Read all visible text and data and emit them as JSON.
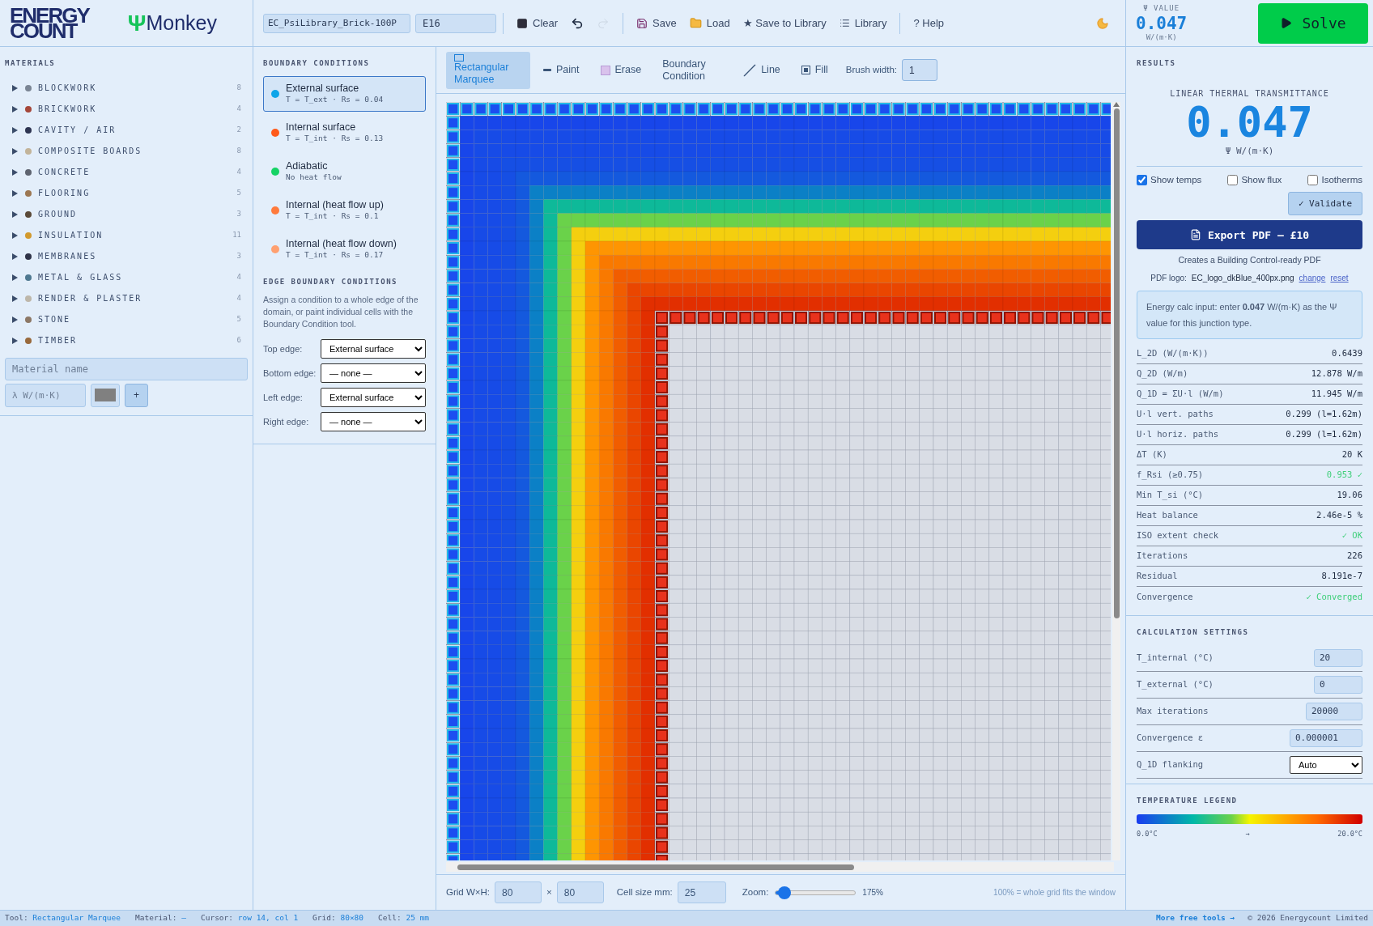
{
  "brand": {
    "wordmark_lines": [
      "ENERGY",
      "COUNT"
    ],
    "app_symbol": "Ψ",
    "app_name": "Monkey"
  },
  "toolbar": {
    "file_name": "EC_PsiLibrary_Brick-100P",
    "junction_code": "E16",
    "buttons": [
      {
        "kind": "clear",
        "label": "Clear",
        "disabled": false
      },
      {
        "kind": "undo",
        "disabled": false
      },
      {
        "kind": "redo",
        "disabled": true
      },
      {
        "kind": "save",
        "label": "Save",
        "disabled": false
      },
      {
        "kind": "load",
        "label": "Load",
        "disabled": false
      },
      {
        "kind": "text",
        "label": "★ Save to Library",
        "disabled": false
      },
      {
        "kind": "library",
        "label": "Library",
        "disabled": false
      },
      {
        "kind": "text",
        "label": "? Help",
        "disabled": false
      }
    ]
  },
  "psi_value": {
    "label": "Ψ VALUE",
    "value": "0.047",
    "unit": "W/(m·K)"
  },
  "solve_button": {
    "label": "Solve"
  },
  "materials": {
    "title": "MATERIALS",
    "groups": [
      {
        "name": "BLOCKWORK",
        "count": "8",
        "color": "#7a8594",
        "expanded": false
      },
      {
        "name": "BRICKWORK",
        "count": "4",
        "color": "#a5473a",
        "expanded": false
      },
      {
        "name": "CAVITY / AIR",
        "count": "2",
        "color": "#2e3552",
        "expanded": false
      },
      {
        "name": "COMPOSITE BOARDS",
        "count": "8",
        "color": "#c2b49a",
        "expanded": false
      },
      {
        "name": "CONCRETE",
        "count": "4",
        "color": "#5e6470",
        "expanded": false
      },
      {
        "name": "FLOORING",
        "count": "5",
        "color": "#9c7752",
        "expanded": false
      },
      {
        "name": "GROUND",
        "count": "3",
        "color": "#5a4a38",
        "expanded": false
      },
      {
        "name": "INSULATION",
        "count": "11",
        "color": "#d29a2e",
        "expanded": false
      },
      {
        "name": "MEMBRANES",
        "count": "3",
        "color": "#2f3348",
        "expanded": false
      },
      {
        "name": "METAL & GLASS",
        "count": "4",
        "color": "#4e7890",
        "expanded": false
      },
      {
        "name": "RENDER & PLASTER",
        "count": "4",
        "color": "#bdb7aa",
        "expanded": false
      },
      {
        "name": "STONE",
        "count": "5",
        "color": "#8c7866",
        "expanded": false
      },
      {
        "name": "TIMBER",
        "count": "6",
        "color": "#98693c",
        "expanded": false
      }
    ],
    "name_placeholder": "Material name",
    "conductivity_placeholder": "λ W/(m·K)",
    "swatch": {
      "color": "#808080"
    },
    "add_label": "+"
  },
  "boundary_conditions": {
    "title": "BOUNDARY CONDITIONS",
    "items": [
      {
        "name": "External surface",
        "detail": "T = T_ext · Rs = 0.04",
        "color": "#0ea5e9",
        "selected": true
      },
      {
        "name": "Internal surface",
        "detail": "T = T_int · Rs = 0.13",
        "color": "#ff5a1a",
        "selected": false
      },
      {
        "name": "Adiabatic",
        "detail": "No heat flow",
        "color": "#16d365",
        "selected": false
      },
      {
        "name": "Internal (heat flow up)",
        "detail": "T = T_int · Rs = 0.1",
        "color": "#ff7a3c",
        "selected": false
      },
      {
        "name": "Internal (heat flow down)",
        "detail": "T = T_int · Rs = 0.17",
        "color": "#ffa070",
        "selected": false
      }
    ]
  },
  "edge_conditions": {
    "title": "EDGE BOUNDARY CONDITIONS",
    "description": "Assign a condition to a whole edge of the domain, or paint individual cells with the Boundary Condition tool.",
    "edges": [
      {
        "label": "Top edge:",
        "value": "External surface"
      },
      {
        "label": "Bottom edge:",
        "value": "— none —"
      },
      {
        "label": "Left edge:",
        "value": "External surface"
      },
      {
        "label": "Right edge:",
        "value": "— none —"
      }
    ]
  },
  "tools": {
    "items": [
      {
        "kind": "marquee",
        "label": "Rectangular Marquee",
        "selected": true
      },
      {
        "kind": "paint",
        "label": "Paint",
        "selected": false
      },
      {
        "kind": "erase",
        "label": "Erase",
        "selected": false
      },
      {
        "kind": "none",
        "label": "Boundary Condition",
        "selected": false
      },
      {
        "kind": "line",
        "label": "Line",
        "selected": false
      },
      {
        "kind": "fill",
        "label": "Fill",
        "selected": false
      }
    ],
    "brush_label": "Brush width:",
    "brush_value": "1"
  },
  "canvas_footer": {
    "grid_label": "Grid W×H:",
    "grid_w": "80",
    "times": "×",
    "grid_h": "80",
    "cell_label": "Cell size mm:",
    "cell_value": "25",
    "zoom_label": "Zoom:",
    "zoom": {
      "level": 0.06,
      "reading": "175%"
    },
    "hint": "100% = whole grid fits the window"
  },
  "results": {
    "title": "RESULTS",
    "headline_label": "LINEAR THERMAL TRANSMITTANCE",
    "headline_value": "0.047",
    "headline_unit": "Ψ W/(m·K)",
    "toggles": [
      {
        "label": "Show temps",
        "checked": true
      },
      {
        "label": "Show flux",
        "checked": false
      },
      {
        "label": "Isotherms",
        "checked": false
      }
    ],
    "validate_label": "✓ Validate",
    "export_label": "Export PDF — £10",
    "export_note": "Creates a Building Control-ready PDF",
    "logo_label": "PDF logo:",
    "logo_file": "EC_logo_dkBlue_400px.png",
    "logo_links": [
      "change",
      "reset"
    ],
    "info": "Energy calc input: enter **0.047** W/(m·K) as the Ψ value for this junction type.",
    "rows": [
      {
        "label": "L_2D (W/(m·K))",
        "value": "0.6439",
        "passed": false
      },
      {
        "label": "Q_2D (W/m)",
        "value": "12.878 W/m",
        "passed": false
      },
      {
        "label": "Q_1D = ΣU·l (W/m)",
        "value": "11.945 W/m",
        "passed": false
      },
      {
        "label": "U·l vert. paths",
        "value": "0.299 (l=1.62m)",
        "passed": false
      },
      {
        "label": "U·l horiz. paths",
        "value": "0.299 (l=1.62m)",
        "passed": false
      },
      {
        "label": "ΔT (K)",
        "value": "20 K",
        "passed": false
      },
      {
        "label": "f_Rsi (≥0.75)",
        "value": "0.953 ✓",
        "passed": true
      },
      {
        "label": "Min T_si (°C)",
        "value": "19.06",
        "passed": false
      },
      {
        "label": "Heat balance",
        "value": "2.46e-5 %",
        "passed": false
      },
      {
        "label": "ISO extent check",
        "value": "✓ OK",
        "passed": true
      },
      {
        "label": "Iterations",
        "value": "226",
        "passed": false
      },
      {
        "label": "Residual",
        "value": "8.191e-7",
        "passed": false
      },
      {
        "label": "Convergence",
        "value": "✓ Converged",
        "passed": true
      }
    ]
  },
  "settings": {
    "title": "CALCULATION SETTINGS",
    "rows": [
      {
        "kind": "input",
        "label": "T_internal (°C)",
        "value": "20"
      },
      {
        "kind": "input",
        "label": "T_external (°C)",
        "value": "0"
      },
      {
        "kind": "input",
        "label": "Max iterations",
        "value": "20000"
      },
      {
        "kind": "input",
        "label": "Convergence ε",
        "value": "0.000001"
      },
      {
        "kind": "select",
        "label": "Q_1D flanking",
        "value": "Auto"
      }
    ]
  },
  "legend": {
    "title": "TEMPERATURE LEGEND",
    "min": "0.0°C",
    "arrow": "→",
    "max": "20.0°C"
  },
  "status_bar": {
    "items": [
      {
        "label": "Tool:",
        "value": "Rectangular Marquee"
      },
      {
        "label": "Material:",
        "value": "—"
      },
      {
        "label": "Cursor:",
        "value": "row 14, col 1"
      },
      {
        "label": "Grid:",
        "value": "80×80"
      },
      {
        "label": "Cell:",
        "value": "25 mm"
      }
    ],
    "link": "More free tools →",
    "copyright": "© 2026 Energycount Limited"
  }
}
